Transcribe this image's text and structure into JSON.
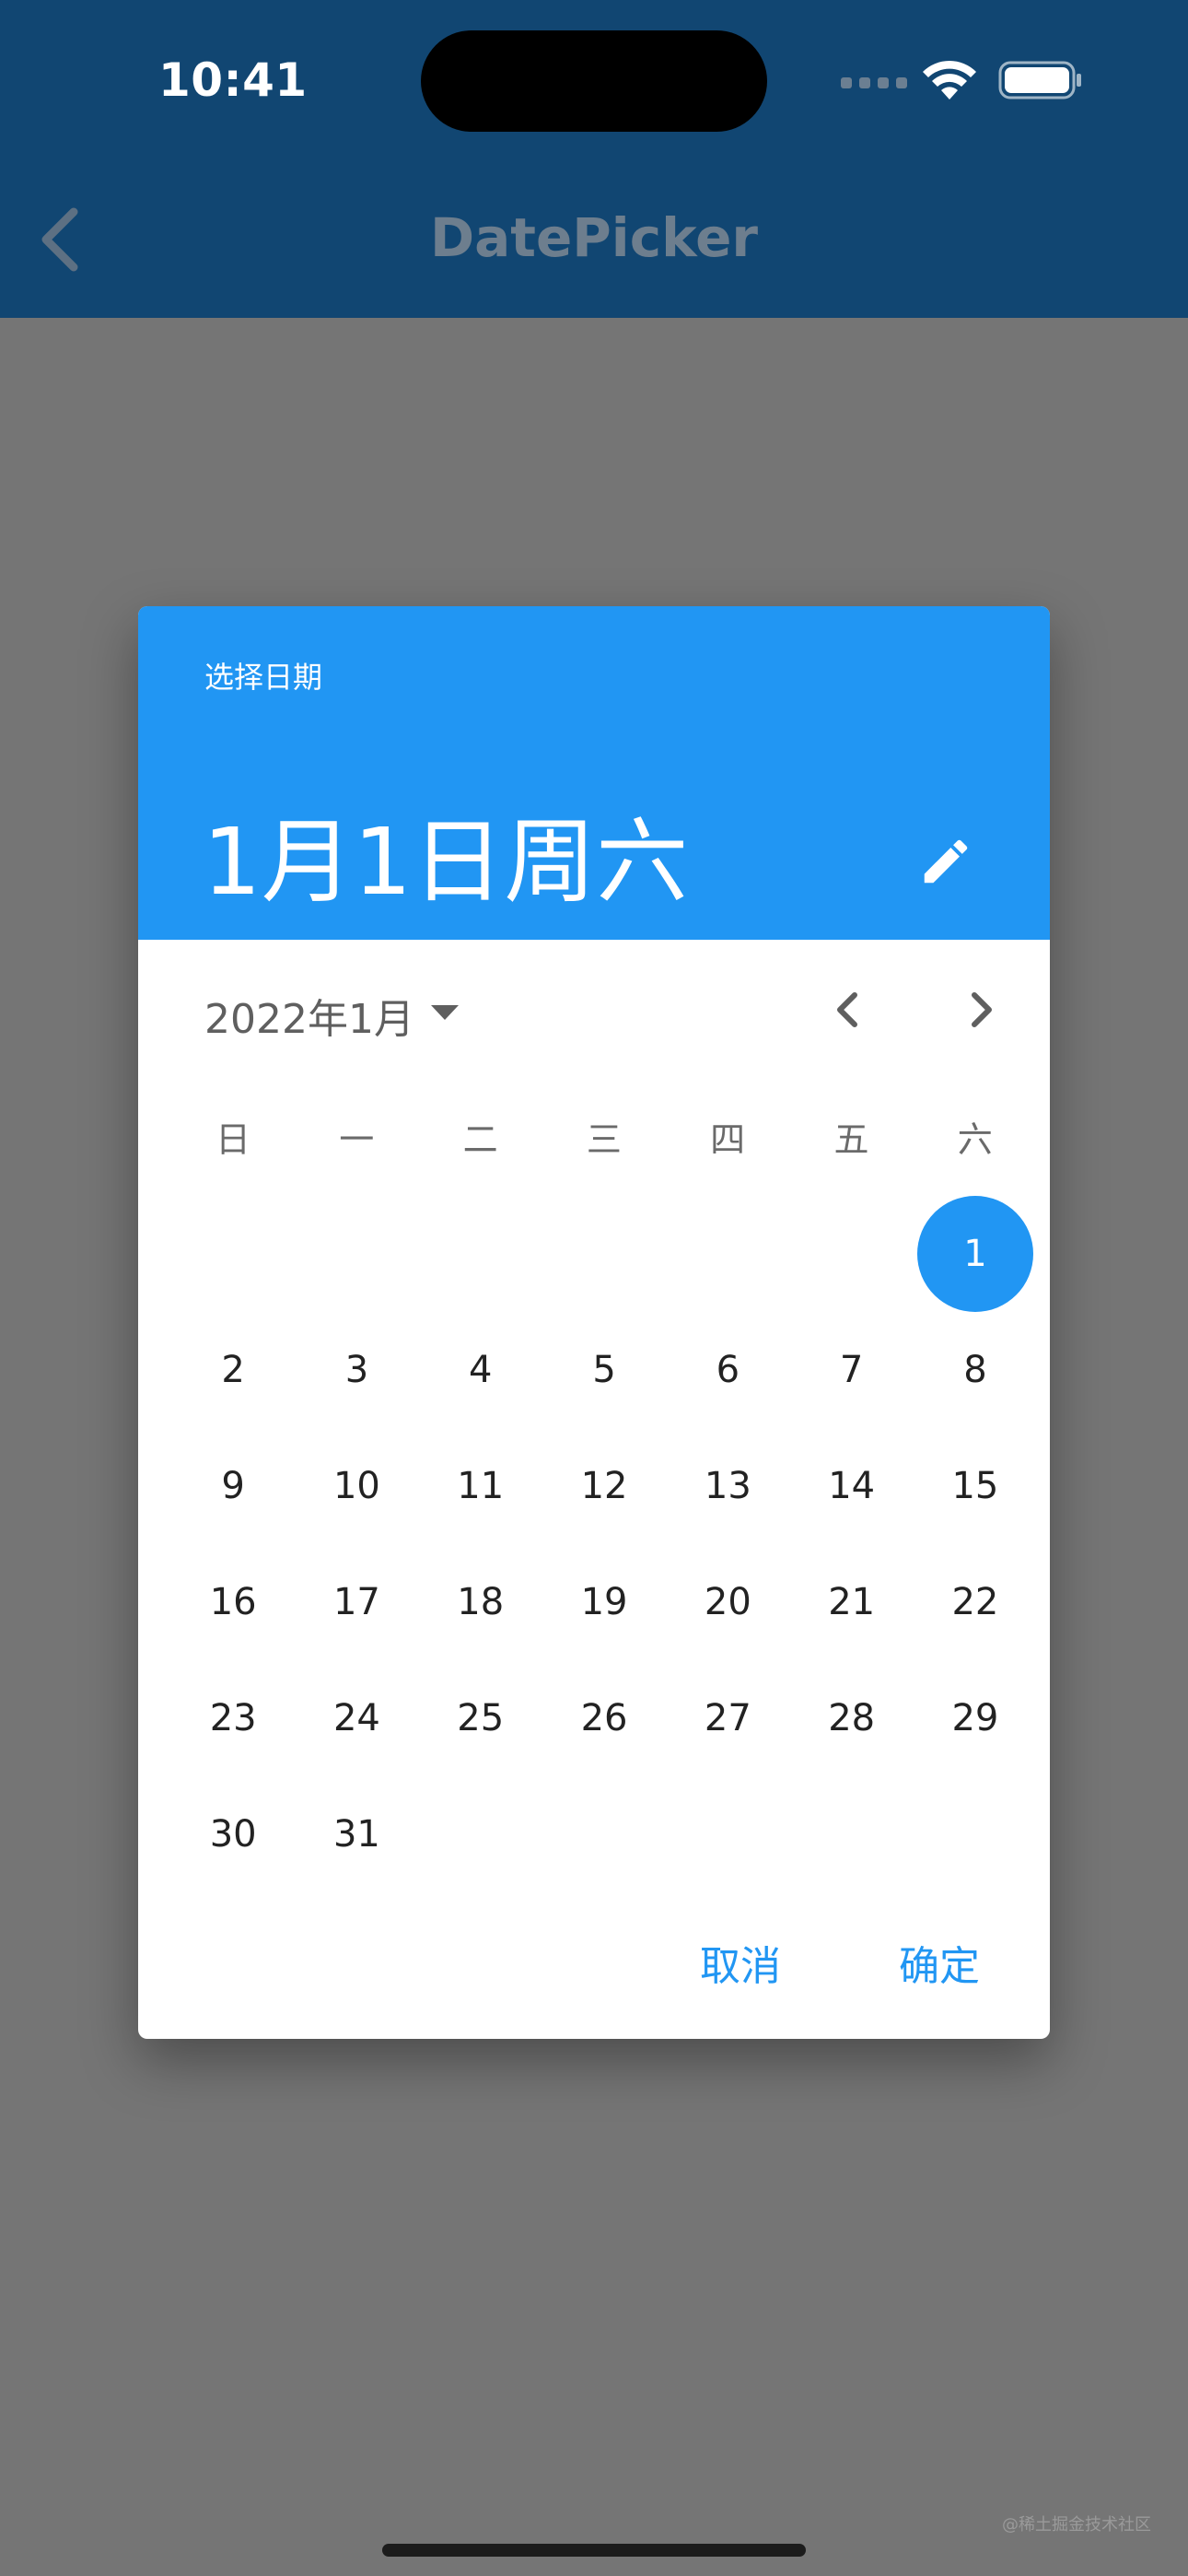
{
  "status_bar": {
    "time": "10:41"
  },
  "app_bar": {
    "title": "DatePicker",
    "back_icon": "chevron-left-icon"
  },
  "date_picker": {
    "help_text": "选择日期",
    "selected_date_text": "1月1日周六",
    "edit_icon": "pencil-icon",
    "month_year_label": "2022年1月",
    "weekdays": [
      "日",
      "一",
      "二",
      "三",
      "四",
      "五",
      "六"
    ],
    "first_day_column": 6,
    "days": [
      "1",
      "2",
      "3",
      "4",
      "5",
      "6",
      "7",
      "8",
      "9",
      "10",
      "11",
      "12",
      "13",
      "14",
      "15",
      "16",
      "17",
      "18",
      "19",
      "20",
      "21",
      "22",
      "23",
      "24",
      "25",
      "26",
      "27",
      "28",
      "29",
      "30",
      "31"
    ],
    "selected_day": "1",
    "cancel_label": "取消",
    "confirm_label": "确定"
  },
  "colors": {
    "app_bar": "#114672",
    "accent": "#2196F3",
    "scrim_background": "#757575"
  },
  "watermark": "@稀土掘金技术社区"
}
